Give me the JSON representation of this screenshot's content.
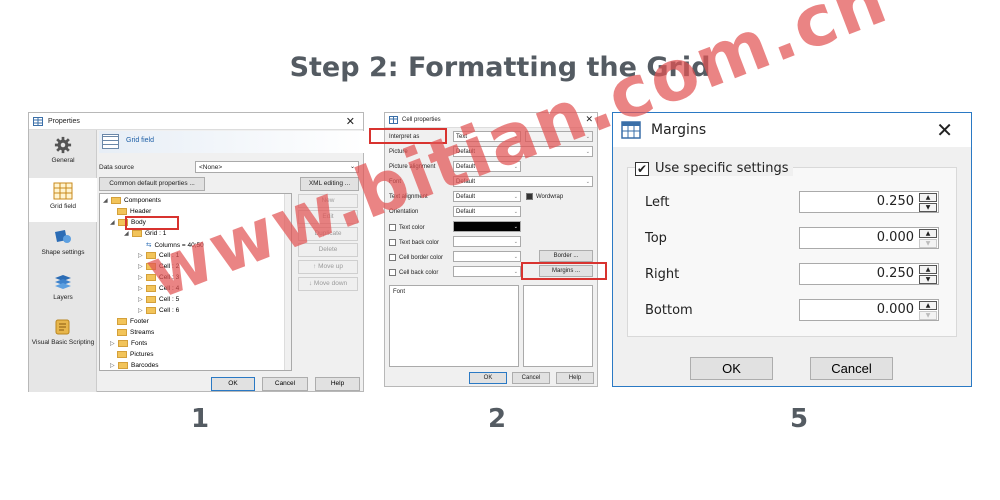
{
  "heading": "Step 2: Formatting the Grid",
  "watermark": "www.bitian.com.cn",
  "step_numbers": [
    "1",
    "2",
    "5"
  ],
  "panel1": {
    "title": "Properties",
    "close": "✕",
    "nav": [
      {
        "label": "General",
        "icon": "gear-icon"
      },
      {
        "label": "Grid field",
        "icon": "grid-icon"
      },
      {
        "label": "Shape settings",
        "icon": "shape-icon"
      },
      {
        "label": "Layers",
        "icon": "layers-icon"
      },
      {
        "label": "Visual Basic Scripting",
        "icon": "script-icon"
      }
    ],
    "header_title": "Grid field",
    "data_source_label": "Data source",
    "data_source_value": "<None>",
    "common_defaults_button": "Common default properties ...",
    "xml_button": "XML editing ...",
    "tree": [
      {
        "text": "Components",
        "arrow": "◢"
      },
      {
        "text": "Header",
        "arrow": ""
      },
      {
        "text": "Body",
        "arrow": "◢"
      },
      {
        "text": "Grid : 1",
        "arrow": "◢"
      },
      {
        "text": "Columns = 40;50",
        "arrow": ""
      },
      {
        "text": "Cell : 1",
        "arrow": "▷"
      },
      {
        "text": "Cell : 2",
        "arrow": "▷"
      },
      {
        "text": "Cell : 3",
        "arrow": "▷"
      },
      {
        "text": "Cell : 4",
        "arrow": "▷"
      },
      {
        "text": "Cell : 5",
        "arrow": "▷"
      },
      {
        "text": "Cell : 6",
        "arrow": "▷"
      },
      {
        "text": "Footer",
        "arrow": ""
      },
      {
        "text": "Streams",
        "arrow": ""
      },
      {
        "text": "Fonts",
        "arrow": "▷"
      },
      {
        "text": "Pictures",
        "arrow": ""
      },
      {
        "text": "Barcodes",
        "arrow": "▷"
      }
    ],
    "side_buttons": [
      "New",
      "Edit",
      "Duplicate",
      "Delete",
      "Move up",
      "Move down"
    ],
    "ok": "OK",
    "cancel": "Cancel",
    "help": "Help"
  },
  "panel2": {
    "title": "Cell properties",
    "close": "✕",
    "rows": [
      {
        "label": "Interpret as",
        "value": "Text"
      },
      {
        "label": "Picture",
        "value": "Default"
      },
      {
        "label": "Picture alignment",
        "value": "Default"
      },
      {
        "label": "Font",
        "value": "Default"
      },
      {
        "label": "Text alignment",
        "value": "Default"
      },
      {
        "label": "Orientation",
        "value": "Default"
      }
    ],
    "wordwrap": "Wordwrap",
    "checks": [
      "Text color",
      "Text back color",
      "Cell border color",
      "Cell back color"
    ],
    "border_button": "Border ...",
    "margins_button": "Margins ...",
    "font_label": "Font",
    "ok": "OK",
    "cancel": "Cancel",
    "help": "Help",
    "text_color_hex": "#000000"
  },
  "panel5": {
    "title": "Margins",
    "close": "✕",
    "use_specific": "Use specific settings",
    "checked": "✔",
    "fields": [
      {
        "label": "Left",
        "value": "0.250"
      },
      {
        "label": "Top",
        "value": "0.000"
      },
      {
        "label": "Right",
        "value": "0.250"
      },
      {
        "label": "Bottom",
        "value": "0.000"
      }
    ],
    "ok": "OK",
    "cancel": "Cancel"
  }
}
